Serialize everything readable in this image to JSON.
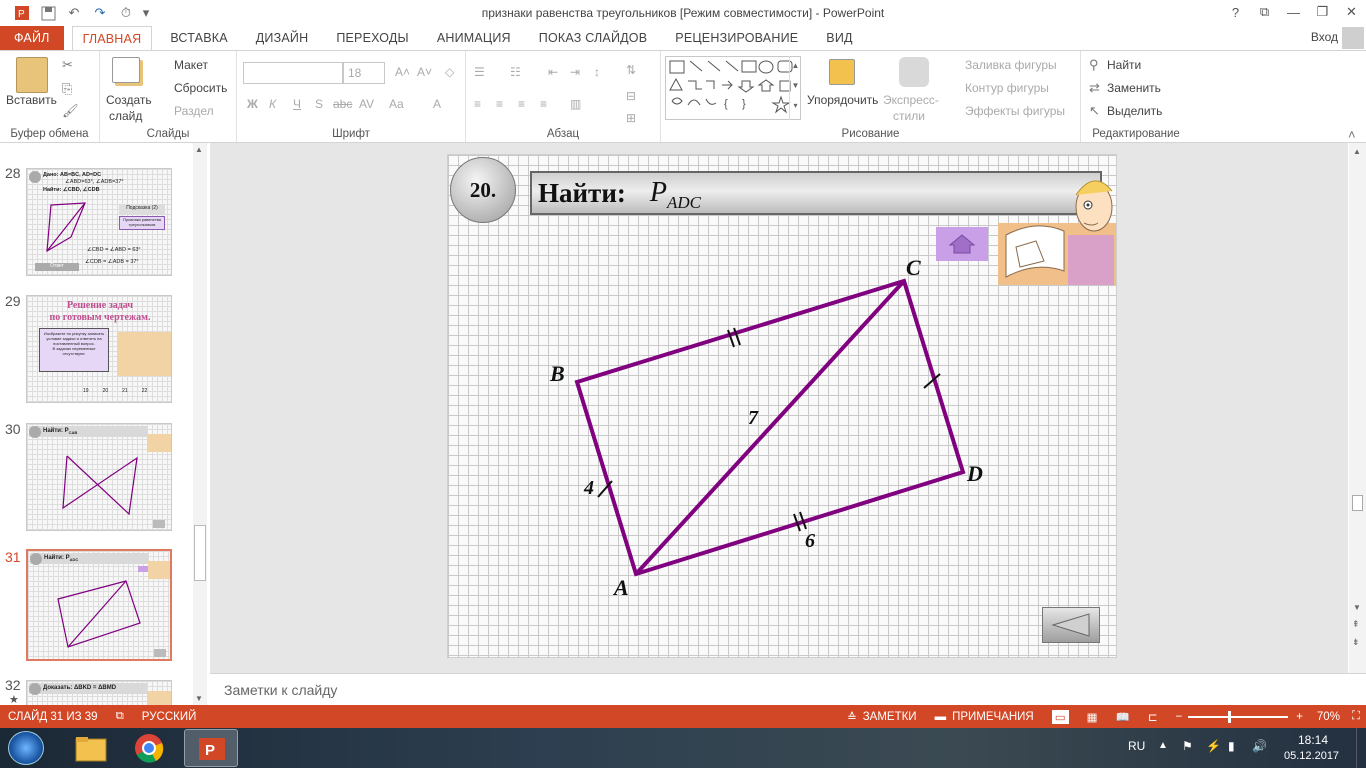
{
  "window": {
    "title": "признаки равенства треугольников [Режим совместимости] - PowerPoint",
    "login": "Вход",
    "help": "?",
    "restore": "⧉",
    "minimize": "—",
    "maximize": "❐",
    "close": "✕"
  },
  "qat": {
    "save": "💾",
    "undo": "↶",
    "redo": "↷",
    "start": "⏱",
    "customize": "▾"
  },
  "tabs": [
    "ФАЙЛ",
    "ГЛАВНАЯ",
    "ВСТАВКА",
    "ДИЗАЙН",
    "ПЕРЕХОДЫ",
    "АНИМАЦИЯ",
    "ПОКАЗ СЛАЙДОВ",
    "РЕЦЕНЗИРОВАНИЕ",
    "ВИД"
  ],
  "ribbon": {
    "clipboard": {
      "label": "Буфер обмена",
      "paste": "Вставить"
    },
    "slides": {
      "label": "Слайды",
      "new_slide": "Создать",
      "new_slide2": "слайд",
      "layout": "Макет",
      "reset": "Сбросить",
      "section": "Раздел"
    },
    "font": {
      "label": "Шрифт",
      "size": "18",
      "bold": "Ж",
      "italic": "К",
      "underline": "Ч",
      "shadow": "S",
      "strike": "abc",
      "spacing": "AV",
      "case": "Aa",
      "color": "A"
    },
    "paragraph": {
      "label": "Абзац"
    },
    "drawing": {
      "label": "Рисование",
      "arrange": "Упорядочить",
      "quick_styles": "Экспресс-",
      "quick_styles2": "стили",
      "fill": "Заливка фигуры",
      "outline": "Контур фигуры",
      "effects": "Эффекты фигуры"
    },
    "editing": {
      "label": "Редактирование",
      "find": "Найти",
      "replace": "Заменить",
      "select": "Выделить"
    }
  },
  "thumbnails": [
    {
      "num": "28",
      "title": "Дано: AB=BC, AD=DC",
      "line2": "∠ABD=63°, ∠ADB=37°",
      "find": "Найти: ∠CBD, ∠CDB",
      "hint": "Подсказка (2)",
      "hint2": "Признаки равенства треугольников",
      "ans1": "∠CBD = ∠ABD = 63°",
      "ans2": "∠CDB = ∠ADB = 37°",
      "answer": "Ответ"
    },
    {
      "num": "29",
      "title": "Решение задач",
      "title2": "по готовым чертежам.",
      "text": "Изобразите по рисунку записать условие задачи и ответить на поставленный вопрос.",
      "text2": "В задачах переменные отсутствуют.",
      "links": [
        "19",
        "20",
        "21",
        "22"
      ]
    },
    {
      "num": "30",
      "title": "Найти: P",
      "sub": "CAB"
    },
    {
      "num": "31",
      "title": "Найти: P",
      "sub": "ADC"
    },
    {
      "num": "32",
      "title": "Доказать: ΔBKD = ΔBMD"
    }
  ],
  "slide": {
    "number": "20.",
    "heading": "Найти:",
    "p": "P",
    "sub": "ADC",
    "labels": {
      "A": "A",
      "B": "B",
      "C": "C",
      "D": "D"
    },
    "lengths": {
      "AB": "4",
      "AC": "7",
      "AD": "6"
    }
  },
  "notes": {
    "placeholder": "Заметки к слайду"
  },
  "status": {
    "slide": "СЛАЙД 31 ИЗ 39",
    "lang": "РУССКИЙ",
    "notes": "ЗАМЕТКИ",
    "comments": "ПРИМЕЧАНИЯ",
    "zoom": "70%"
  },
  "taskbar": {
    "lang": "RU",
    "time": "18:14",
    "date": "05.12.2017"
  }
}
